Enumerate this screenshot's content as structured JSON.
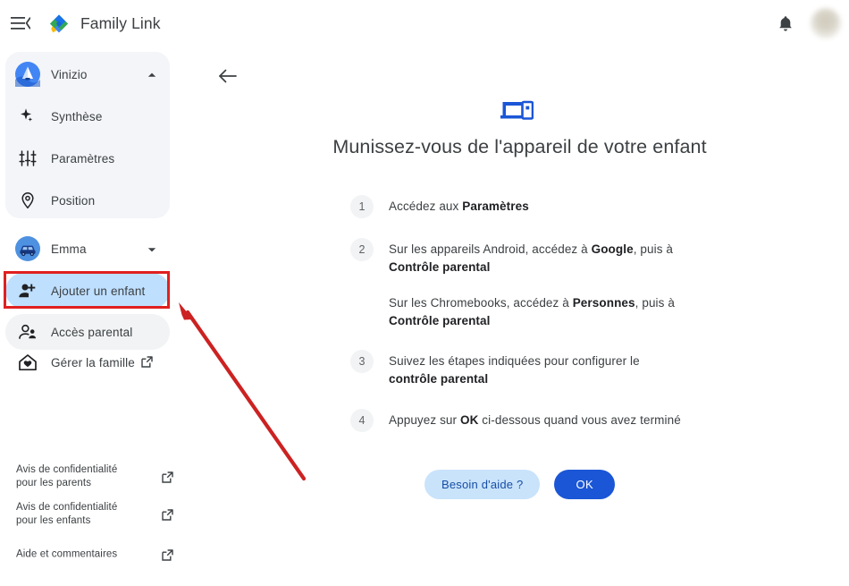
{
  "topbar": {
    "menu_icon": "hamburger-collapse-icon",
    "logo_icon": "family-link-logo",
    "title": "Family Link",
    "bell_icon": "notifications-bell-icon",
    "avatar_icon": "user-avatar"
  },
  "sidebar": {
    "family": {
      "name": "Vinizio",
      "avatar_icon": "vinizio-avatar",
      "expand_icon": "chevron-up-icon",
      "items": [
        {
          "label": "Synthèse",
          "icon": "sparkle-icon"
        },
        {
          "label": "Paramètres",
          "icon": "sliders-icon"
        },
        {
          "label": "Position",
          "icon": "location-pin-icon"
        }
      ]
    },
    "child": {
      "name": "Emma",
      "avatar_icon": "emma-avatar-car",
      "expand_icon": "chevron-down-icon"
    },
    "actions": [
      {
        "label": "Ajouter un enfant",
        "icon": "person-add-icon",
        "state": "selected"
      },
      {
        "label": "Accès parental",
        "icon": "supervised-user-icon",
        "state": "hover"
      },
      {
        "label": "Gérer la famille",
        "icon": "home-heart-icon",
        "state": "default",
        "external": true
      }
    ],
    "footer": [
      {
        "label": "Avis de confidentialité pour les parents",
        "icon": "external-link-icon"
      },
      {
        "label": "Avis de confidentialité pour les enfants",
        "icon": "external-link-icon"
      },
      {
        "label": "Aide et commentaires",
        "icon": "external-link-icon"
      }
    ]
  },
  "main": {
    "back_icon": "back-arrow-icon",
    "hero_icon": "devices-icon",
    "title": "Munissez-vous de l'appareil de votre enfant",
    "steps": [
      {
        "number": "1",
        "parts": [
          {
            "text": "Accédez aux ",
            "bold": false
          },
          {
            "text": "Paramètres",
            "bold": true
          }
        ]
      },
      {
        "number": "2",
        "parts": [
          {
            "text": "Sur les appareils Android, accédez à ",
            "bold": false
          },
          {
            "text": "Google",
            "bold": true
          },
          {
            "text": ", puis à ",
            "bold": false
          },
          {
            "text": "Contrôle parental",
            "bold": true
          }
        ]
      },
      {
        "number": "",
        "parts": [
          {
            "text": "Sur les Chromebooks, accédez à ",
            "bold": false
          },
          {
            "text": "Personnes",
            "bold": true
          },
          {
            "text": ", puis à ",
            "bold": false
          },
          {
            "text": "Contrôle parental",
            "bold": true
          }
        ]
      },
      {
        "number": "3",
        "parts": [
          {
            "text": "Suivez les étapes indiquées pour configurer le ",
            "bold": false
          },
          {
            "text": "contrôle parental",
            "bold": true
          }
        ]
      },
      {
        "number": "4",
        "parts": [
          {
            "text": "Appuyez sur ",
            "bold": false
          },
          {
            "text": "OK",
            "bold": true
          },
          {
            "text": " ci-dessous quand vous avez terminé",
            "bold": false
          }
        ]
      }
    ],
    "help_button": "Besoin d'aide ?",
    "ok_button": "OK"
  },
  "annotations": {
    "highlight_color": "#e02020",
    "arrow_from": "340,535",
    "arrow_to": "202,340"
  },
  "colors": {
    "accent_blue": "#1a56d6",
    "selected_pill": "#bfdfff",
    "help_pill": "#c9e3fb",
    "card_bg": "#f3f5f9",
    "annotation_red": "#e02020"
  }
}
